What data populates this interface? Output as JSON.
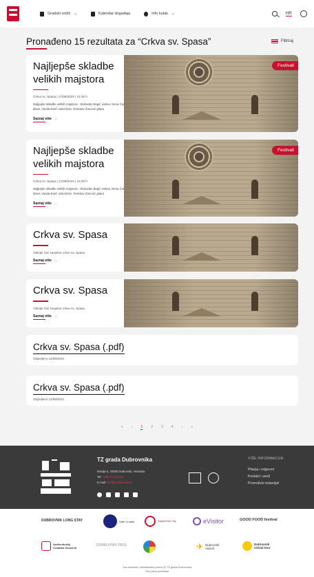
{
  "header": {
    "nav": [
      {
        "label": "Gradski vodič",
        "icon": "map-pin-icon"
      },
      {
        "label": "Kalendar događaja",
        "icon": "calendar-icon"
      },
      {
        "label": "Info kutak",
        "icon": "info-icon"
      }
    ],
    "chevron": "⌄",
    "language": "HR"
  },
  "results": {
    "title": "Pronađeno 15 rezultata za “Crkva sv. Spasa”",
    "filter_label": "Filtriraj"
  },
  "cards": [
    {
      "title": "Najljepše skladbe velikih majstora",
      "meta": "Crkva sv. Spasa | 17/09/2024 | 21:00 h",
      "desc": "Najljepše skladbe velikih majstora - Slobodan Begić violina, Nena Čorak klavir, Vanda Đurić violončelo, Tomislav Žonović gitara",
      "link": "Saznaj više",
      "badge": "Festivali"
    },
    {
      "title": "Najljepše skladbe velikih majstora",
      "meta": "Crkva sv. Spasa | 17/09/2024 | 21:00 h",
      "desc": "Najljepše skladbe velikih majstora - Slobodan Begić violina, Nena Čorak klavir, Vanda Đurić violončelo, Tomislav Žonović gitara",
      "link": "Saznaj više",
      "badge": "Festivali"
    },
    {
      "title": "Crkva sv. Spasa",
      "meta": "Otkrijte čari zavjetne crkve sv. Spasa",
      "link": "Saznaj više"
    },
    {
      "title": "Crkva sv. Spasa",
      "meta": "Otkrijte čari zavjetne crkve sv. Spasa",
      "link": "Saznaj više"
    }
  ],
  "pdfs": [
    {
      "title": "Crkva sv. Spasa (.pdf)",
      "date": "Objavljeno 12/09/2024"
    },
    {
      "title": "Crkva sv. Spasa (.pdf)",
      "date": "Objavljeno 12/09/2024"
    }
  ],
  "pagination": {
    "first": "«",
    "prev": "‹",
    "pages": [
      "1",
      "2",
      "3",
      "4"
    ],
    "next": "›",
    "last": "»",
    "current": "1"
  },
  "footer": {
    "org": "TZ grada Dubrovnika",
    "address": "Brsalje 5, 20000 Dubrovnik, Hrvatska",
    "tel_label": "Tel:",
    "tel": "+385 20 312 011",
    "email_label": "E-mail:",
    "email": "info@tzdubrovnik.hr",
    "more_title": "VIŠE INFORMACIJA",
    "links": [
      "Pitanja i odgovori",
      "Kontakt i uredi",
      "Promotivni materijali"
    ],
    "socials": [
      "facebook-icon",
      "x-icon",
      "youtube-icon",
      "linkedin-icon",
      "instagram-icon"
    ]
  },
  "partners": {
    "items": [
      "DUBROVNIK LONG STAY",
      "Safe Croatia",
      "Respect the City",
      "eVisitor",
      "GOOD FOOD festival",
      "Authentically Croatian Souvenir",
      "DUBROVNIK PASS",
      "Dubrovnik Airport",
      "Dubrovnik virtual tour"
    ],
    "legal_line1": "Sva autorska i intelektualna prava (©) TZ grada Dubrovnika",
    "legal_line2": "Sva prava pridržana"
  },
  "colors": {
    "accent": "#c8102e",
    "footer_bg": "#3a3a3a",
    "page_bg": "#f3f3f3"
  }
}
